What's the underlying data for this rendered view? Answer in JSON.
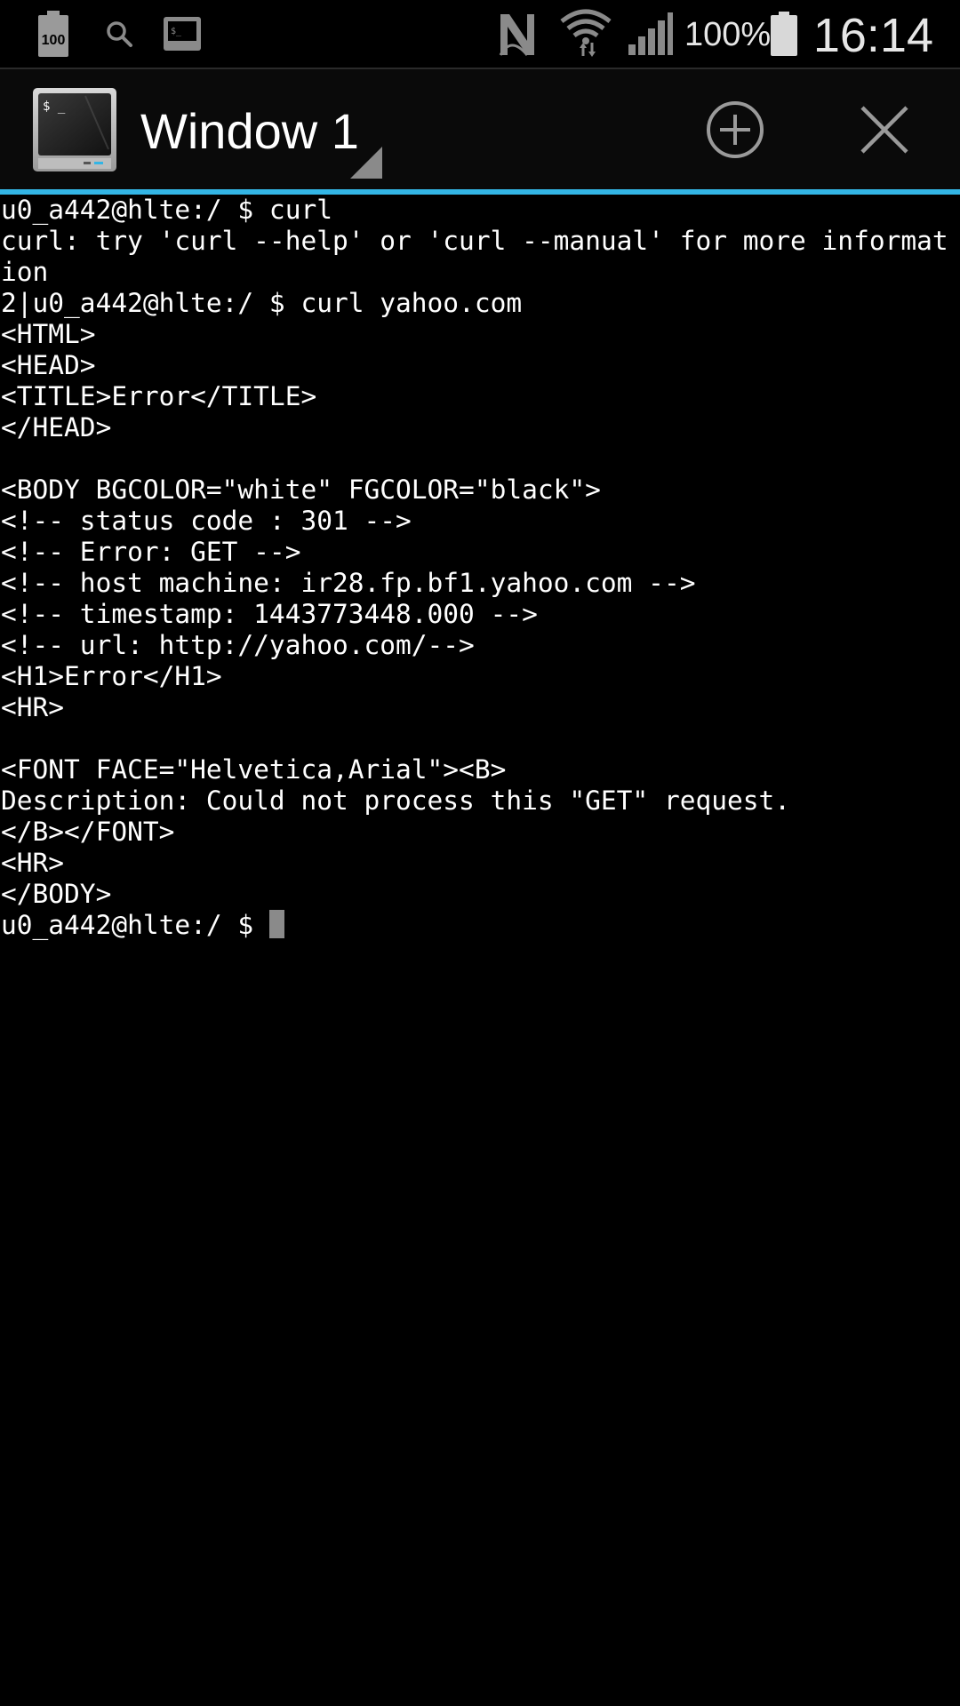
{
  "status_bar": {
    "battery_saver_label": "100",
    "battery_percent": "100%",
    "clock": "16:14",
    "icons": [
      "battery-icon",
      "search-icon",
      "terminal-icon",
      "nfc-icon",
      "wifi-icon",
      "signal-icon",
      "battery-icon"
    ]
  },
  "action_bar": {
    "window_title": "Window 1",
    "app_icon_prompt": "$ _",
    "new_window_icon": "plus-circle-icon",
    "close_icon": "close-icon"
  },
  "terminal": {
    "lines": [
      "u0_a442@hlte:/ $ curl",
      "curl: try 'curl --help' or 'curl --manual' for more informat",
      "ion",
      "2|u0_a442@hlte:/ $ curl yahoo.com",
      "<HTML>",
      "<HEAD>",
      "<TITLE>Error</TITLE>",
      "</HEAD>",
      "",
      "<BODY BGCOLOR=\"white\" FGCOLOR=\"black\">",
      "<!-- status code : 301 -->",
      "<!-- Error: GET -->",
      "<!-- host machine: ir28.fp.bf1.yahoo.com -->",
      "<!-- timestamp: 1443773448.000 -->",
      "<!-- url: http://yahoo.com/-->",
      "<H1>Error</H1>",
      "<HR>",
      "",
      "<FONT FACE=\"Helvetica,Arial\"><B>",
      "Description: Could not process this \"GET\" request.",
      "</B></FONT>",
      "<HR>",
      "</BODY>"
    ],
    "prompt": "u0_a442@hlte:/ $ "
  },
  "colors": {
    "accent": "#33b5e5",
    "background": "#000000",
    "text": "#ffffff",
    "cursor": "#8a8a8a"
  }
}
